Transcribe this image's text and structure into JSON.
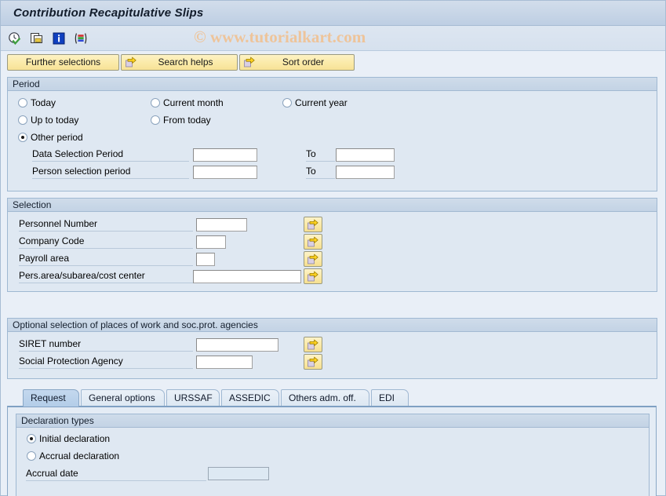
{
  "window": {
    "title": "Contribution Recapitulative Slips"
  },
  "watermark": "© www.tutorialkart.com",
  "toolbar": {
    "icons": [
      {
        "name": "execute-clock-check-icon",
        "tooltip": "Execute"
      },
      {
        "name": "copy-variant-icon",
        "tooltip": "Get variant"
      },
      {
        "name": "information-icon",
        "tooltip": "Information"
      },
      {
        "name": "color-bars-icon",
        "tooltip": "Display as table"
      }
    ]
  },
  "buttons": {
    "further_selections": "Further selections",
    "search_helps": "Search helps",
    "sort_order": "Sort order"
  },
  "period": {
    "legend": "Period",
    "options": [
      {
        "label": "Today",
        "selected": false
      },
      {
        "label": "Current month",
        "selected": false
      },
      {
        "label": "Current year",
        "selected": false
      },
      {
        "label": "Up to today",
        "selected": false
      },
      {
        "label": "From today",
        "selected": false
      },
      {
        "label": "Other period",
        "selected": true
      }
    ],
    "rows": [
      {
        "label": "Data Selection Period",
        "from_value": "",
        "to_label": "To",
        "to_value": ""
      },
      {
        "label": "Person selection period",
        "from_value": "",
        "to_label": "To",
        "to_value": ""
      }
    ]
  },
  "selection": {
    "legend": "Selection",
    "rows": [
      {
        "label": "Personnel Number",
        "value": "",
        "has_select_button": true
      },
      {
        "label": "Company Code",
        "value": "",
        "has_select_button": true
      },
      {
        "label": "Payroll area",
        "value": "",
        "has_select_button": true
      },
      {
        "label": "Pers.area/subarea/cost center",
        "value": "",
        "has_select_button": true
      }
    ]
  },
  "optional": {
    "legend": "Optional selection of places of work and soc.prot. agencies",
    "rows": [
      {
        "label": "SIRET number",
        "value": "",
        "has_select_button": true
      },
      {
        "label": "Social Protection Agency",
        "value": "",
        "has_select_button": true
      }
    ]
  },
  "tabs": [
    {
      "label": "Request",
      "active": true
    },
    {
      "label": "General options",
      "active": false
    },
    {
      "label": "URSSAF",
      "active": false
    },
    {
      "label": "ASSEDIC",
      "active": false
    },
    {
      "label": "Others adm. off.",
      "active": false
    },
    {
      "label": "EDI",
      "active": false
    }
  ],
  "declaration": {
    "legend": "Declaration types",
    "options": [
      {
        "label": "Initial declaration",
        "selected": true
      },
      {
        "label": "Accrual declaration",
        "selected": false
      }
    ],
    "accrual_date_label": "Accrual date",
    "accrual_date_value": ""
  },
  "colors": {
    "window_background": "#e9eff7",
    "panel_background": "#dfe8f2",
    "panel_border": "#9fb8d2",
    "title_bar": "#c8d6e7",
    "button_yellow": "#fbebab",
    "tab_active": "#b3cde8",
    "watermark": "#eec49a"
  }
}
